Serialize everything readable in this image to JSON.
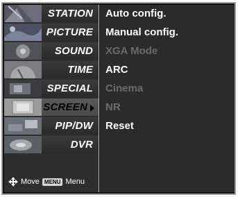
{
  "menu": {
    "items": [
      {
        "label": "STATION",
        "thumb": "station-thumbnail-icon"
      },
      {
        "label": "PICTURE",
        "thumb": "picture-thumbnail-icon"
      },
      {
        "label": "SOUND",
        "thumb": "sound-thumbnail-icon"
      },
      {
        "label": "TIME",
        "thumb": "time-thumbnail-icon"
      },
      {
        "label": "SPECIAL",
        "thumb": "special-thumbnail-icon"
      },
      {
        "label": "SCREEN",
        "thumb": "screen-thumbnail-icon",
        "selected": true
      },
      {
        "label": "PIP/DW",
        "thumb": "pip-thumbnail-icon"
      },
      {
        "label": "DVR",
        "thumb": "dvr-thumbnail-icon"
      }
    ],
    "hint": {
      "move_label": "Move",
      "menu_key": "MENU",
      "menu_label": "Menu"
    }
  },
  "submenu": {
    "options": [
      {
        "label": "Auto config.",
        "enabled": true
      },
      {
        "label": "Manual config.",
        "enabled": true
      },
      {
        "label": "XGA Mode",
        "enabled": false
      },
      {
        "label": "ARC",
        "enabled": true
      },
      {
        "label": "Cinema",
        "enabled": false
      },
      {
        "label": "NR",
        "enabled": false
      },
      {
        "label": "Reset",
        "enabled": true
      }
    ]
  },
  "colors": {
    "panel": "#2b2b2b",
    "enabled_text": "#ffffff",
    "disabled_text": "#6b6b6b",
    "selected_row": "#5a5a5a"
  }
}
